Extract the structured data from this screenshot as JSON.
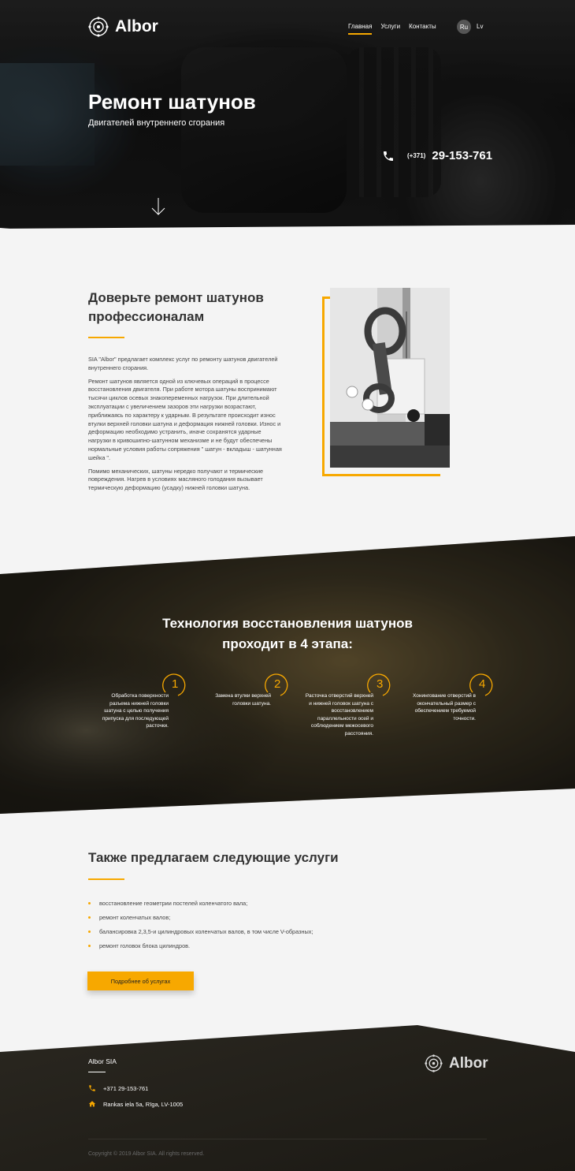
{
  "brand": {
    "name": "Albor"
  },
  "nav": {
    "items": [
      "Главная",
      "Услуги",
      "Контакты"
    ],
    "lang_ru": "Ru",
    "lang_lv": "Lv"
  },
  "hero": {
    "title": "Ремонт шатунов",
    "subtitle": "Двигателей внутреннего сгорания",
    "phone_code": "(+371)",
    "phone_number": "29-153-761"
  },
  "about": {
    "title": "Доверьте ремонт шатунов профессионалам",
    "paragraphs": [
      "SIA \"Albor\" предлагает комплекс услуг по ремонту шатунов двигателей внутреннего сгорания.",
      "Ремонт шатунов является одной из ключевых операций в процессе восстановления двигателя. При работе мотора шатуны воспринимают тысячи циклов осевых знакопеременных нагрузок. При длительной эксплуатации с увеличением зазоров эти нагрузки возрастают, приближаясь по характеру к ударным. В результате происходит износ втулки верхней головки шатуна и деформация нижней головки. Износ и деформацию необходимо устранить, иначе сохранятся ударные нагрузки в кривошипно-шатунном механизме и не будут обеспечены нормальные условия работы сопряжения \" шатун - вкладыш - шатунная шейка \".",
      "Помимо механических, шатуны нередко получают и термические повреждения. Нагрев в условиях масляного голодания вызывает термическую деформацию (усадку) нижней головки шатуна."
    ]
  },
  "steps": {
    "title": "Технология восстановления шатунов проходит в 4 этапа:",
    "items": [
      {
        "num": "1",
        "text": "Обработка поверхности разъема нижней головки шатуна с целью получения припуска для последующей расточки."
      },
      {
        "num": "2",
        "text": "Замена втулки верхней головки шатуна."
      },
      {
        "num": "3",
        "text": "Расточка отверстий верхней и нижней головок шатуна с восстановлением параллельности осей и соблюдением межосевого расстояния."
      },
      {
        "num": "4",
        "text": "Хонингование отверстий в окончательный размер с обеспечением требуемой точности."
      }
    ]
  },
  "services": {
    "title": "Также предлагаем следующие услуги",
    "items": [
      "восстановление геометрии постелей коленчатого вала;",
      "ремонт коленчатых валов;",
      "балансировка 2,3,5-и цилиндровых коленчатых валов, в том числе V-образных;",
      "ремонт головок блока цилиндров."
    ],
    "button": "Подробнее об услугах"
  },
  "footer": {
    "company": "Albor SIA",
    "phone": "+371 29-153-761",
    "address": "Rankas iela 5a, Rīga, LV-1005",
    "copyright": "Copyright © 2019 Albor SIA. All rights reserved."
  },
  "colors": {
    "accent": "#f7a800",
    "dark": "#1e1c17",
    "light_bg": "#f4f4f4"
  },
  "icons": [
    "gear-logo-icon",
    "phone-icon",
    "arrow-down-icon",
    "home-icon"
  ]
}
